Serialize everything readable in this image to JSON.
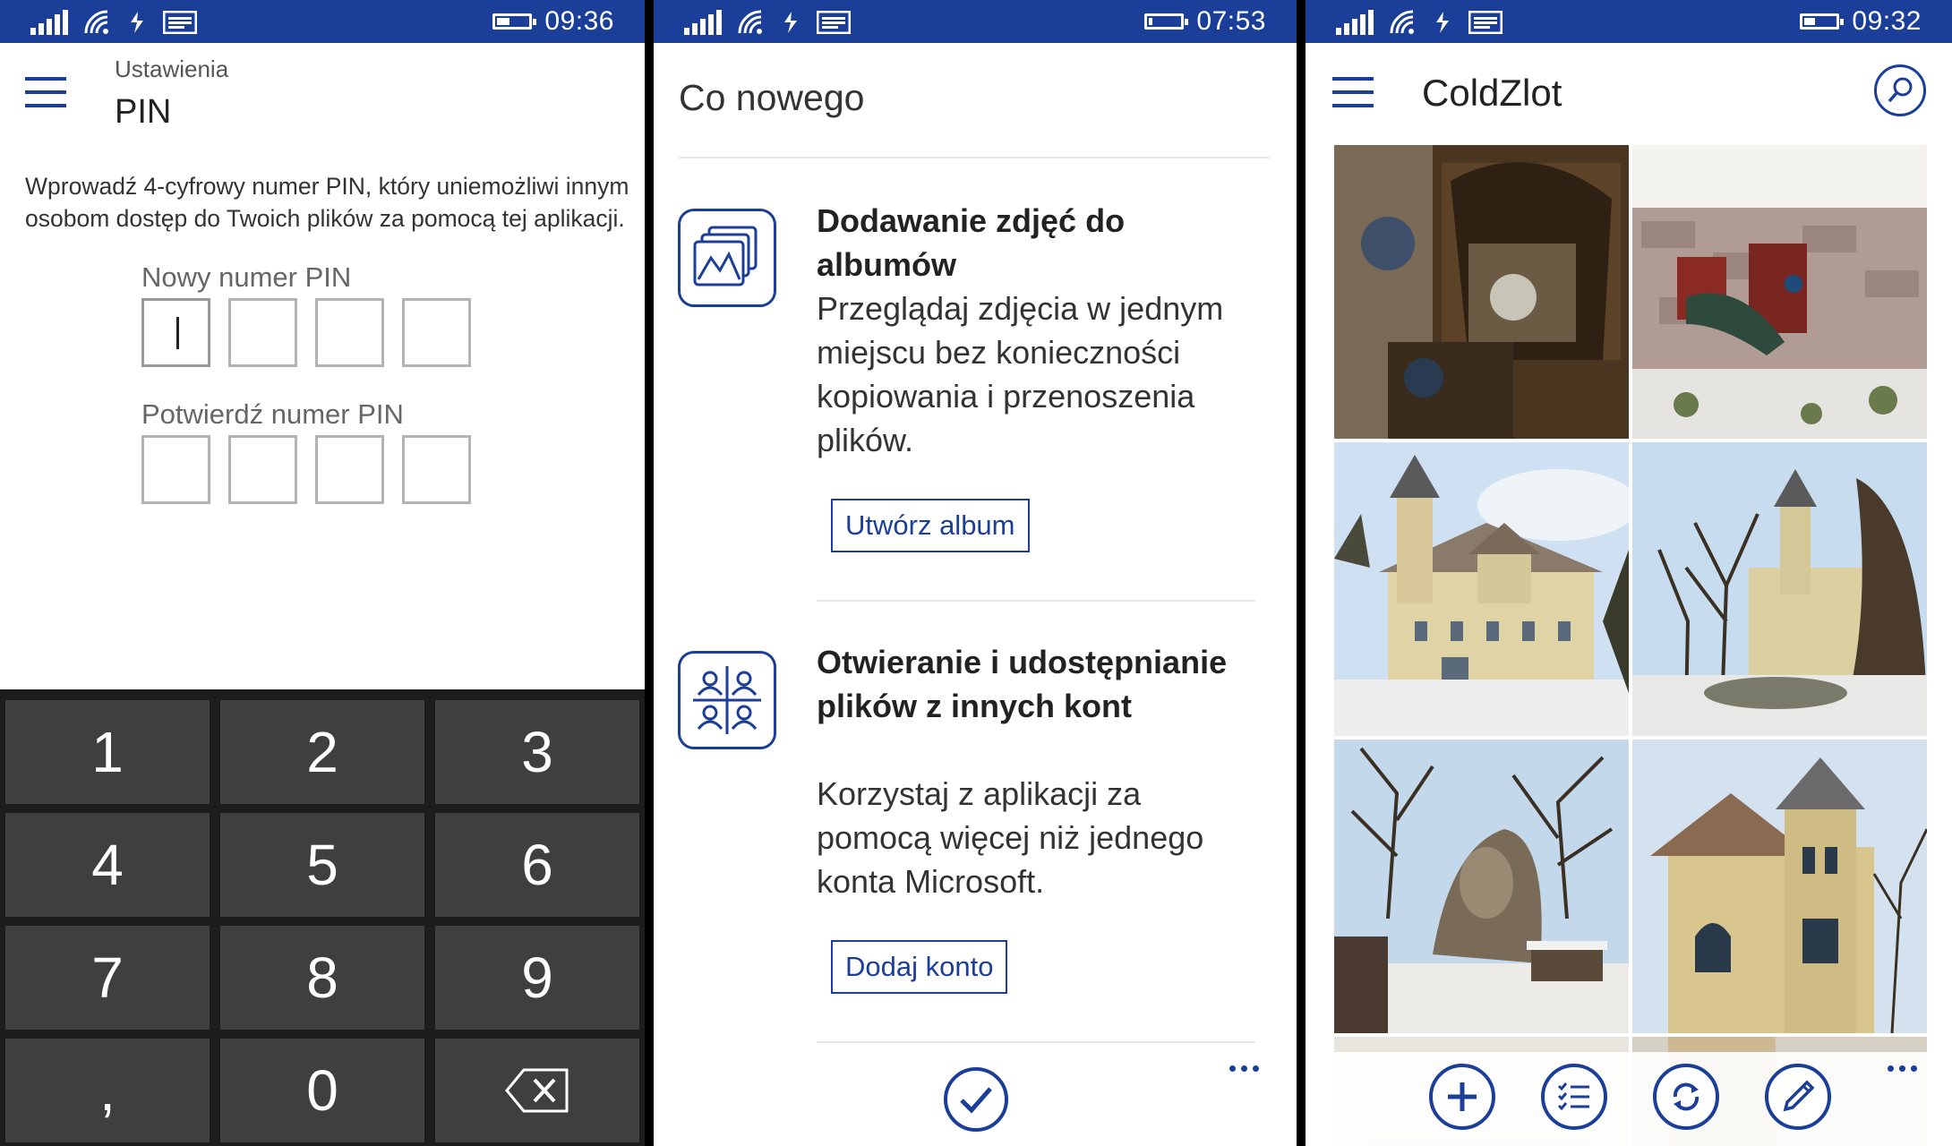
{
  "colors": {
    "accent": "#1b3e99",
    "status_bar": "#1b3e99",
    "keypad_bg": "#1c1c1c",
    "key_bg": "#3f3f3f"
  },
  "screens": {
    "pin": {
      "status_time": "09:36",
      "subtitle": "Ustawienia",
      "title": "PIN",
      "description": "Wprowadź 4-cyfrowy numer PIN, który uniemożliwi innym osobom dostęp do Twoich plików za pomocą tej aplikacji.",
      "new_pin_label": "Nowy numer PIN",
      "confirm_pin_label": "Potwierdź numer PIN",
      "keys": [
        "1",
        "2",
        "3",
        "4",
        "5",
        "6",
        "7",
        "8",
        "9",
        ",",
        "0"
      ],
      "backspace_icon": "backspace-icon"
    },
    "whats_new": {
      "status_time": "07:53",
      "title": "Co nowego",
      "features": [
        {
          "icon": "album-photos-icon",
          "title": "Dodawanie zdjęć do albumów",
          "description": "Przeglądaj zdjęcia w jednym miejscu bez konieczności kopiowania i przenoszenia plików.",
          "button": "Utwórz album"
        },
        {
          "icon": "multiple-accounts-icon",
          "title": "Otwieranie i udostępnianie plików z innych kont",
          "description": "Korzystaj z aplikacji za pomocą więcej niż jednego konta Microsoft.",
          "button": "Dodaj konto"
        }
      ],
      "confirm_icon": "checkmark-icon"
    },
    "album": {
      "status_time": "09:32",
      "title": "ColdZlot",
      "photos": [
        "photo-restaurant-interior",
        "photo-peacock-wall",
        "photo-castle-front",
        "photo-castle-trees",
        "photo-rock-garden-snow",
        "photo-castle-tower"
      ],
      "appbar_icons": [
        "add-icon",
        "select-icon",
        "sync-icon",
        "edit-icon"
      ]
    }
  }
}
